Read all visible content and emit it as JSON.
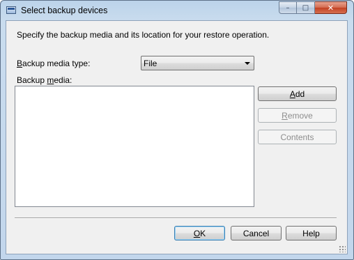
{
  "window": {
    "title": "Select backup devices",
    "caption_buttons": {
      "minimize": "–",
      "maximize": "□",
      "close": "✕"
    }
  },
  "dialog": {
    "description": "Specify the backup media and its location for your restore operation.",
    "media_type": {
      "label_mnemonic": "B",
      "label_rest": "ackup media type:",
      "selected": "File"
    },
    "media": {
      "label_prefix": "Backup ",
      "label_mnemonic": "m",
      "label_rest": "edia:",
      "items": []
    },
    "side_buttons": {
      "add": {
        "mnemonic": "A",
        "rest": "dd",
        "enabled": true
      },
      "remove": {
        "mnemonic": "R",
        "rest": "emove",
        "enabled": false
      },
      "contents": {
        "label": "Contents",
        "enabled": false
      }
    },
    "footer_buttons": {
      "ok": {
        "mnemonic": "O",
        "rest": "K"
      },
      "cancel": {
        "label": "Cancel"
      },
      "help": {
        "label": "Help"
      }
    }
  }
}
